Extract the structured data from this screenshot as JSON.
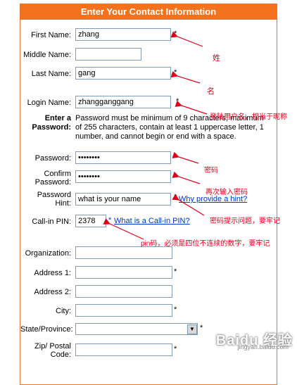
{
  "header": {
    "title": "Enter Your Contact Information"
  },
  "fields": {
    "first_name": {
      "label": "First Name:",
      "value": "zhang"
    },
    "middle_name": {
      "label": "Middle Name:",
      "value": ""
    },
    "last_name": {
      "label": "Last Name:",
      "value": "gang"
    },
    "login_name": {
      "label": "Login Name:",
      "value": "zhangganggang"
    },
    "enter_password": {
      "label_line1": "Enter a",
      "label_line2": "Password:",
      "note_line1": "Password must be minimum of 9 characters, maximum",
      "note_line2": "of 255 characters, contain at least 1 uppercase letter, 1",
      "note_line3": "number, and cannot begin or end with a space."
    },
    "password": {
      "label": "Password:",
      "value": "••••••••"
    },
    "confirm_password": {
      "label_line1": "Confirm",
      "label_line2": "Password:",
      "value": "••••••••"
    },
    "password_hint": {
      "label_line1": "Password",
      "label_line2": "Hint:",
      "value": "what is your name",
      "link": "Why provide a hint?"
    },
    "callin_pin": {
      "label": "Call-in PIN:",
      "value": "2378",
      "link": "What is a Call-in PIN?"
    },
    "organization": {
      "label": "Organization:",
      "value": ""
    },
    "address1": {
      "label": "Address 1:",
      "value": ""
    },
    "address2": {
      "label": "Address 2:",
      "value": ""
    },
    "city": {
      "label": "City:",
      "value": ""
    },
    "state": {
      "label": "State/Province:",
      "value": ""
    },
    "zip": {
      "label_line1": "Zip/ Postal",
      "label_line2": "Code:",
      "value": ""
    }
  },
  "required_mark": "*",
  "annotations": {
    "surname": "姓",
    "given_name": "名",
    "login": "登陆用户名，相当于昵称",
    "password": "密码",
    "confirm": "再次输入密码",
    "hint": "密码提示问题，要牢记",
    "pin": "pin码，必须是四位不连续的数字，要牢记"
  },
  "watermark": {
    "brand": "Baidu 经验",
    "url": "jingyan.baidu.com"
  },
  "colors": {
    "header_bg": "#f4711d",
    "annotation": "#e0001a",
    "link": "#0033cc"
  }
}
